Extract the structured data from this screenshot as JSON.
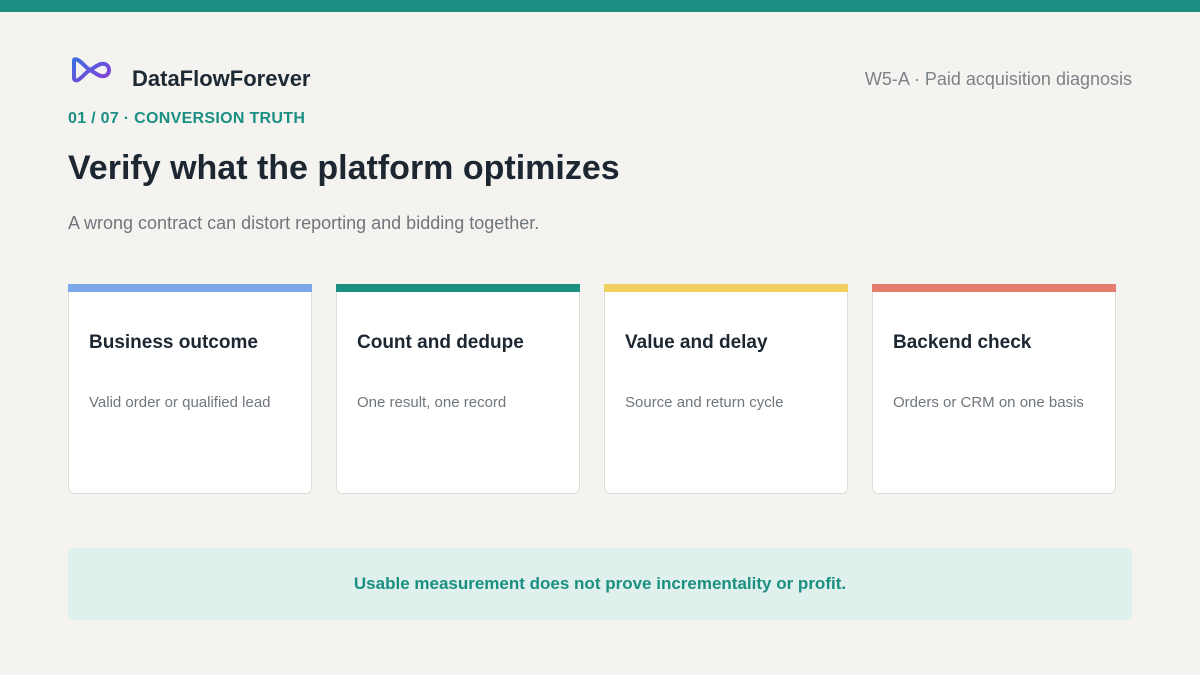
{
  "colors": {
    "brand": "#1a8f82",
    "card_1_accent": "#7ea7ea",
    "card_2_accent": "#1a8f82",
    "card_3_accent": "#f2d060",
    "card_4_accent": "#e67c6e",
    "callout_bg": "#e0f0ec"
  },
  "header": {
    "logo_icon": "infinity-loop-icon",
    "brand_name": "DataFlowForever",
    "context": "W5-A · Paid acquisition diagnosis"
  },
  "slide": {
    "eyebrow": "01 / 07 · CONVERSION TRUTH",
    "title": "Verify what the platform optimizes",
    "subtitle": "A wrong contract can distort reporting and bidding together."
  },
  "cards": [
    {
      "title": "Business outcome",
      "description": "Valid order or qualified lead"
    },
    {
      "title": "Count and dedupe",
      "description": "One result, one record"
    },
    {
      "title": "Value and delay",
      "description": "Source and return cycle"
    },
    {
      "title": "Backend check",
      "description": "Orders or CRM on one basis"
    }
  ],
  "callout": {
    "text": "Usable measurement does not prove incrementality or profit."
  }
}
